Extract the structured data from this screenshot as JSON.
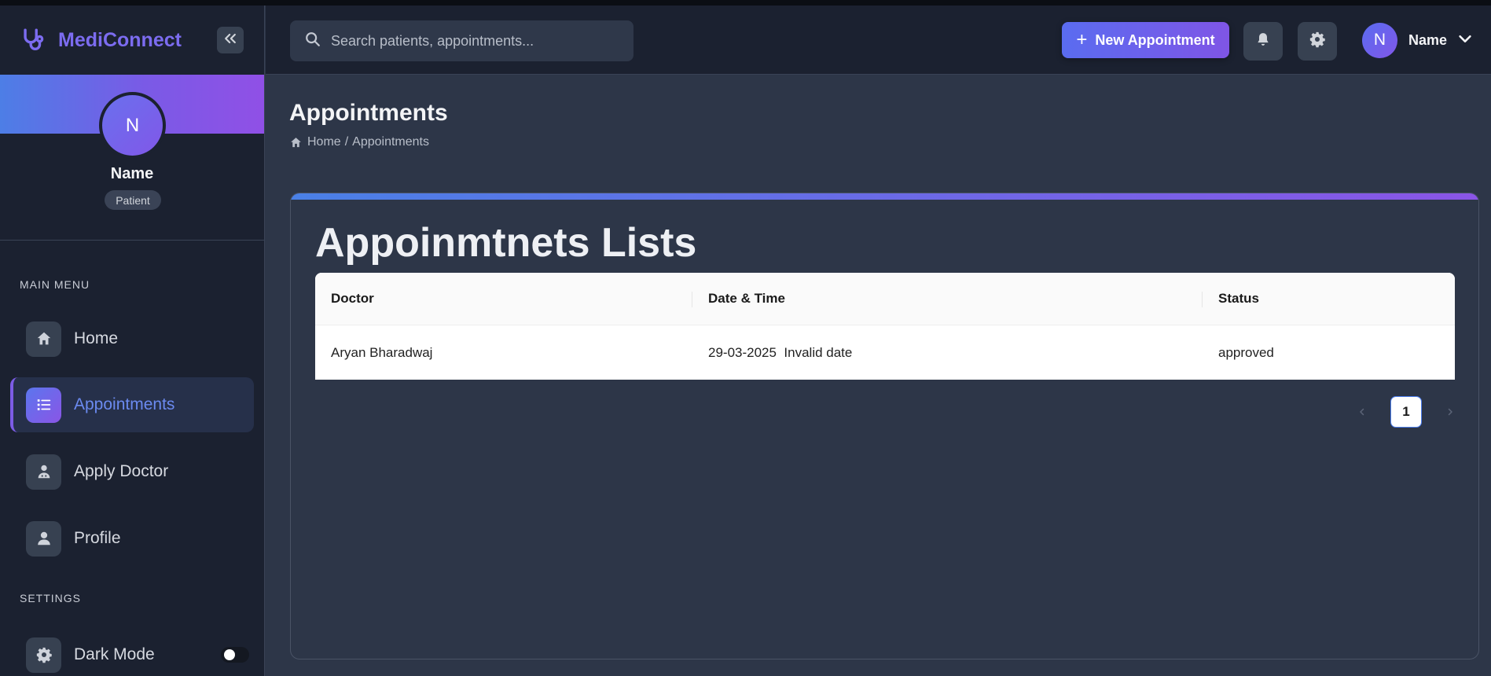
{
  "app": {
    "name": "MediConnect"
  },
  "sidebar": {
    "profile": {
      "initial": "N",
      "name": "Name",
      "role": "Patient"
    },
    "main_menu_label": "MAIN MENU",
    "items": [
      {
        "label": "Home",
        "icon": "home-icon"
      },
      {
        "label": "Appointments",
        "icon": "list-icon",
        "active": true
      },
      {
        "label": "Apply Doctor",
        "icon": "doctor-icon"
      },
      {
        "label": "Profile",
        "icon": "user-icon"
      }
    ],
    "settings_label": "SETTINGS",
    "dark_mode": {
      "label": "Dark Mode",
      "enabled": false
    }
  },
  "header": {
    "search_placeholder": "Search patients, appointments...",
    "new_appointment_label": "New Appointment",
    "user": {
      "initial": "N",
      "name": "Name"
    }
  },
  "page": {
    "title": "Appointments",
    "breadcrumb": {
      "home": "Home",
      "separator": "/",
      "current": "Appointments"
    }
  },
  "card": {
    "title": "Appoinmtnets Lists",
    "columns": [
      "Doctor",
      "Date & Time",
      "Status"
    ],
    "rows": [
      {
        "doctor": "Aryan Bharadwaj",
        "datetime": "29-03-2025  Invalid date",
        "status": "approved"
      }
    ],
    "pagination": {
      "current": "1"
    }
  },
  "colors": {
    "accent_start": "#5a6cf0",
    "accent_end": "#8157e8",
    "sidebar_bg": "#1b2130",
    "main_bg": "#2d3648"
  }
}
